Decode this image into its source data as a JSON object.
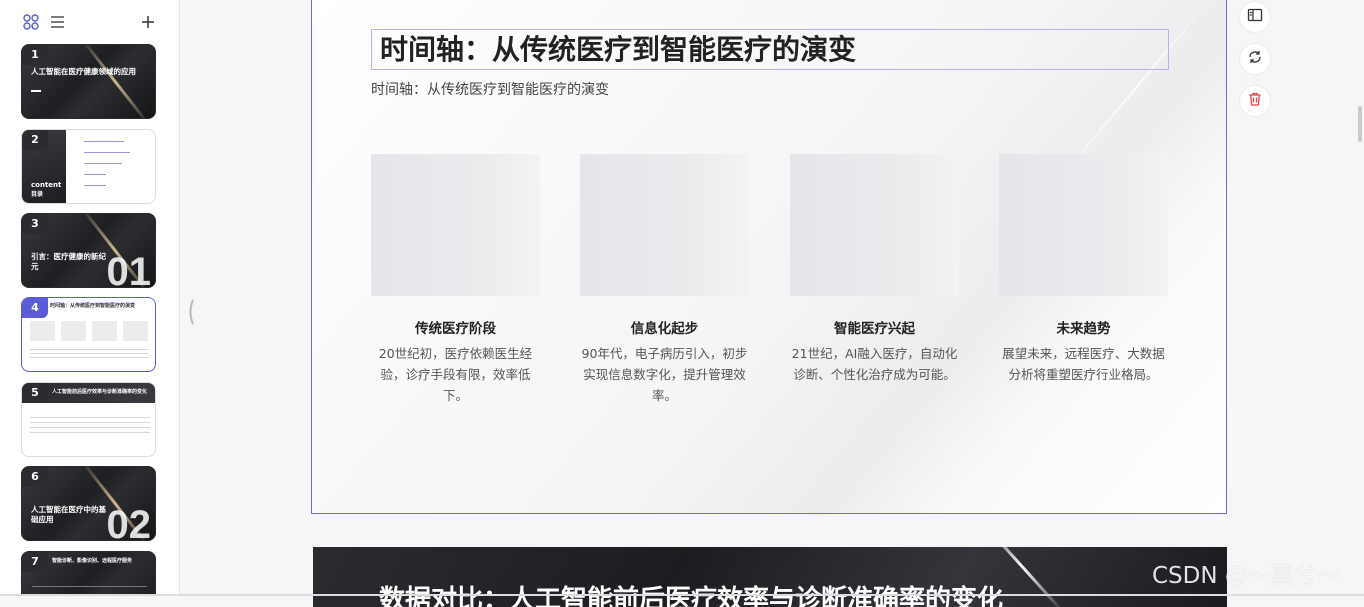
{
  "sidebar": {
    "thumbnails": [
      {
        "num": "1",
        "title": "人工智能在医疗健康领域的应用",
        "style": "dark"
      },
      {
        "num": "2",
        "title": "content",
        "subtitle": "目录",
        "style": "split"
      },
      {
        "num": "3",
        "title": "引言：医疗健康的新纪元",
        "big": "01",
        "style": "dark"
      },
      {
        "num": "4",
        "title": "时间轴：从传统医疗到智能医疗的演变",
        "style": "light",
        "selected": true
      },
      {
        "num": "5",
        "title": "人工智能前后医疗效率与诊断准确率的变化",
        "style": "light"
      },
      {
        "num": "6",
        "title": "人工智能在医疗中的基础应用",
        "big": "02",
        "style": "dark"
      },
      {
        "num": "7",
        "title": "智能诊断、影像识别、远程医疗服务",
        "style": "dark"
      }
    ]
  },
  "slide": {
    "title": "时间轴：从传统医疗到智能医疗的演变",
    "subtitle": "时间轴：从传统医疗到智能医疗的演变",
    "cards": [
      {
        "title": "传统医疗阶段",
        "desc": "20世纪初，医疗依赖医生经验，诊疗手段有限，效率低下。"
      },
      {
        "title": "信息化起步",
        "desc": "90年代，电子病历引入，初步实现信息数字化，提升管理效率。"
      },
      {
        "title": "智能医疗兴起",
        "desc": "21世纪，AI融入医疗，自动化诊断、个性化治疗成为可能。"
      },
      {
        "title": "未来趋势",
        "desc": "展望未来，远程医疗、大数据分析将重塑医疗行业格局。"
      }
    ]
  },
  "next_slide": {
    "title": "数据对比：人工智能前后医疗效率与诊断准确率的变化"
  },
  "watermark": "CSDN @～莫兮～",
  "colors": {
    "accent": "#5b5bd6",
    "delete": "#e54545"
  }
}
